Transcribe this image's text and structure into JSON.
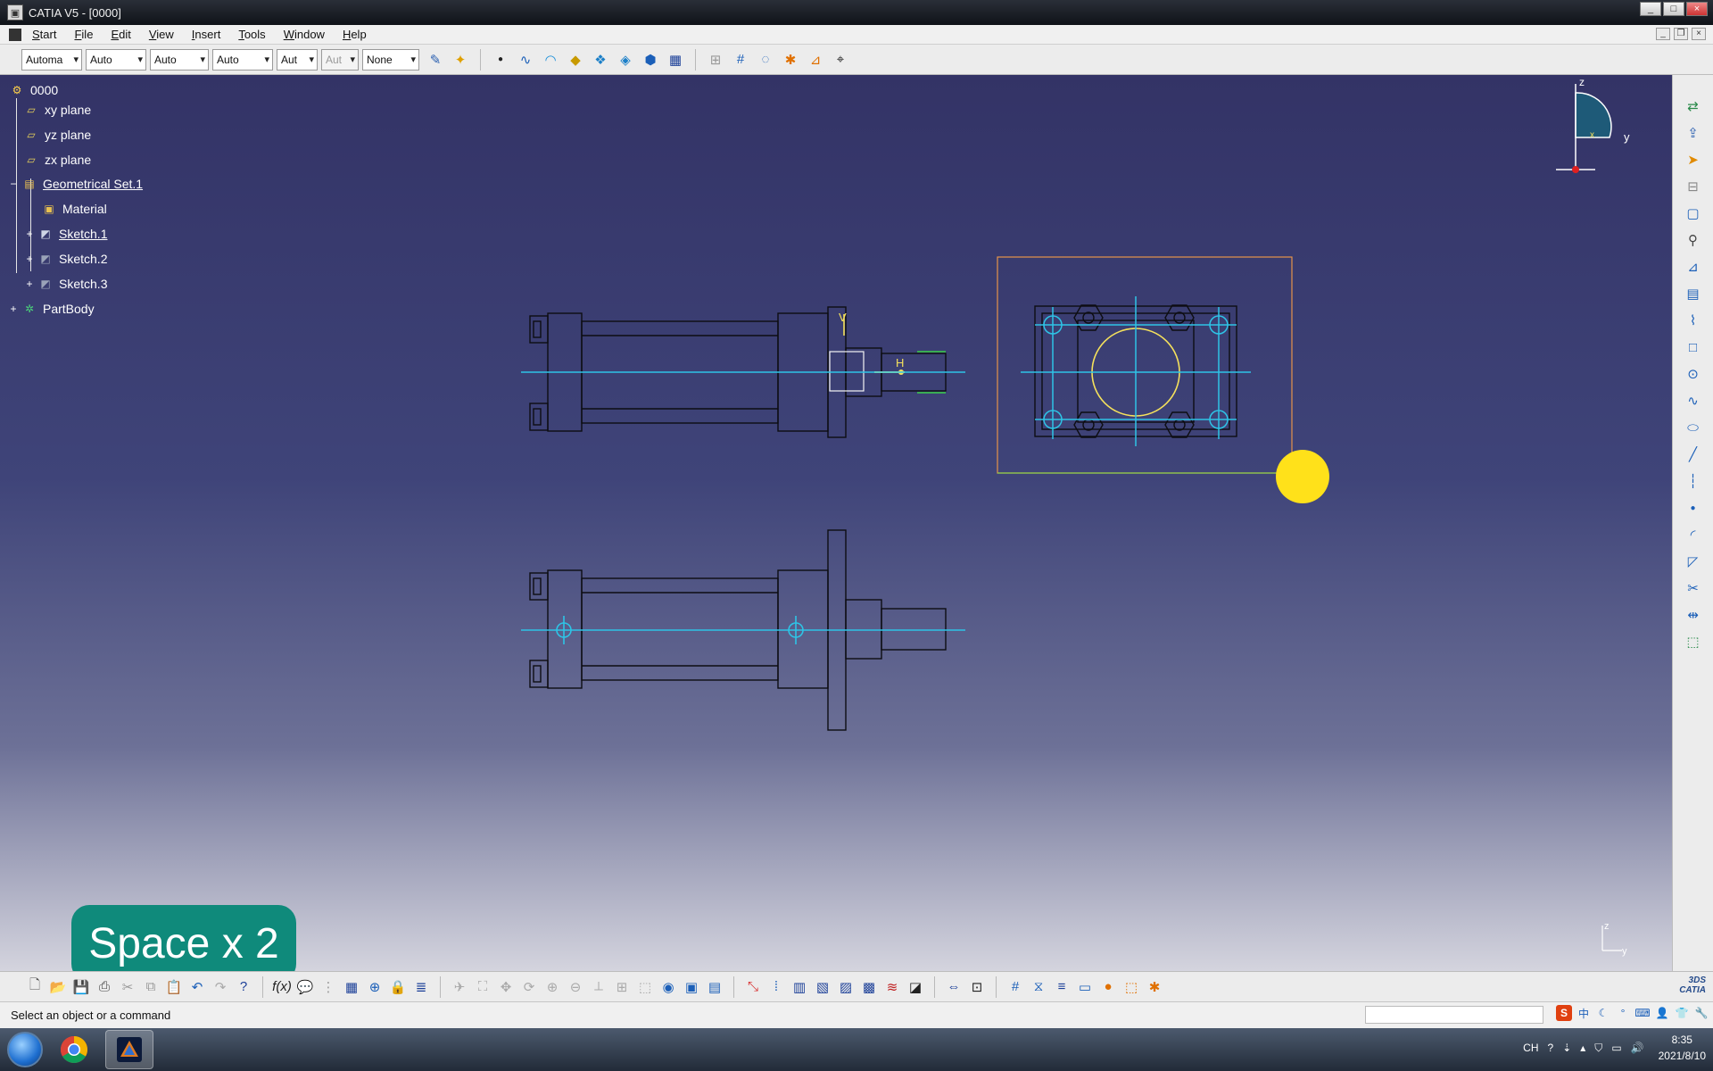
{
  "window": {
    "title": "CATIA V5 - [0000]",
    "controls": [
      "_",
      "□",
      "×"
    ]
  },
  "menu": {
    "items": [
      "Start",
      "File",
      "Edit",
      "View",
      "Insert",
      "Tools",
      "Window",
      "Help"
    ]
  },
  "toolbar_top": {
    "combos": [
      {
        "value": "Automa",
        "disabled": false
      },
      {
        "value": "Auto",
        "disabled": false
      },
      {
        "value": "Auto",
        "disabled": false
      },
      {
        "value": "Auto",
        "disabled": false
      },
      {
        "value": "Aut",
        "disabled": false
      },
      {
        "value": "Aut",
        "disabled": true
      },
      {
        "value": "None",
        "disabled": false
      }
    ]
  },
  "tree": {
    "root": "0000",
    "items": [
      {
        "label": "xy plane",
        "icon": "plane-icon",
        "underline": false
      },
      {
        "label": "yz plane",
        "icon": "plane-icon",
        "underline": false
      },
      {
        "label": "zx plane",
        "icon": "plane-icon",
        "underline": false
      },
      {
        "label": "Geometrical Set.1",
        "icon": "geometrical-set-icon",
        "underline": true
      },
      {
        "label": "Material",
        "icon": "material-icon",
        "underline": false
      },
      {
        "label": "Sketch.1",
        "icon": "sketch-icon",
        "underline": true
      },
      {
        "label": "Sketch.2",
        "icon": "sketch-icon",
        "underline": false
      },
      {
        "label": "Sketch.3",
        "icon": "sketch-icon",
        "underline": false
      },
      {
        "label": "PartBody",
        "icon": "partbody-icon",
        "underline": false
      }
    ]
  },
  "viewport": {
    "overlay_text": "Space x 2",
    "compass_labels": {
      "z": "z",
      "y": "y",
      "x": "x"
    },
    "mini_axis": {
      "z": "z",
      "y": "y"
    },
    "sketch_labels": {
      "v": "V",
      "h": "H"
    }
  },
  "status": {
    "message": "Select an object or a command"
  },
  "taskbar": {
    "lang": "CH",
    "time": "8:35",
    "date": "2021/8/10"
  },
  "colors": {
    "viewport_top": "#333366",
    "construction_line": "#2ec4e6",
    "highlight": "#f5e15c",
    "cursor_marker": "#ffe11a",
    "badge": "#0f8a7b"
  }
}
